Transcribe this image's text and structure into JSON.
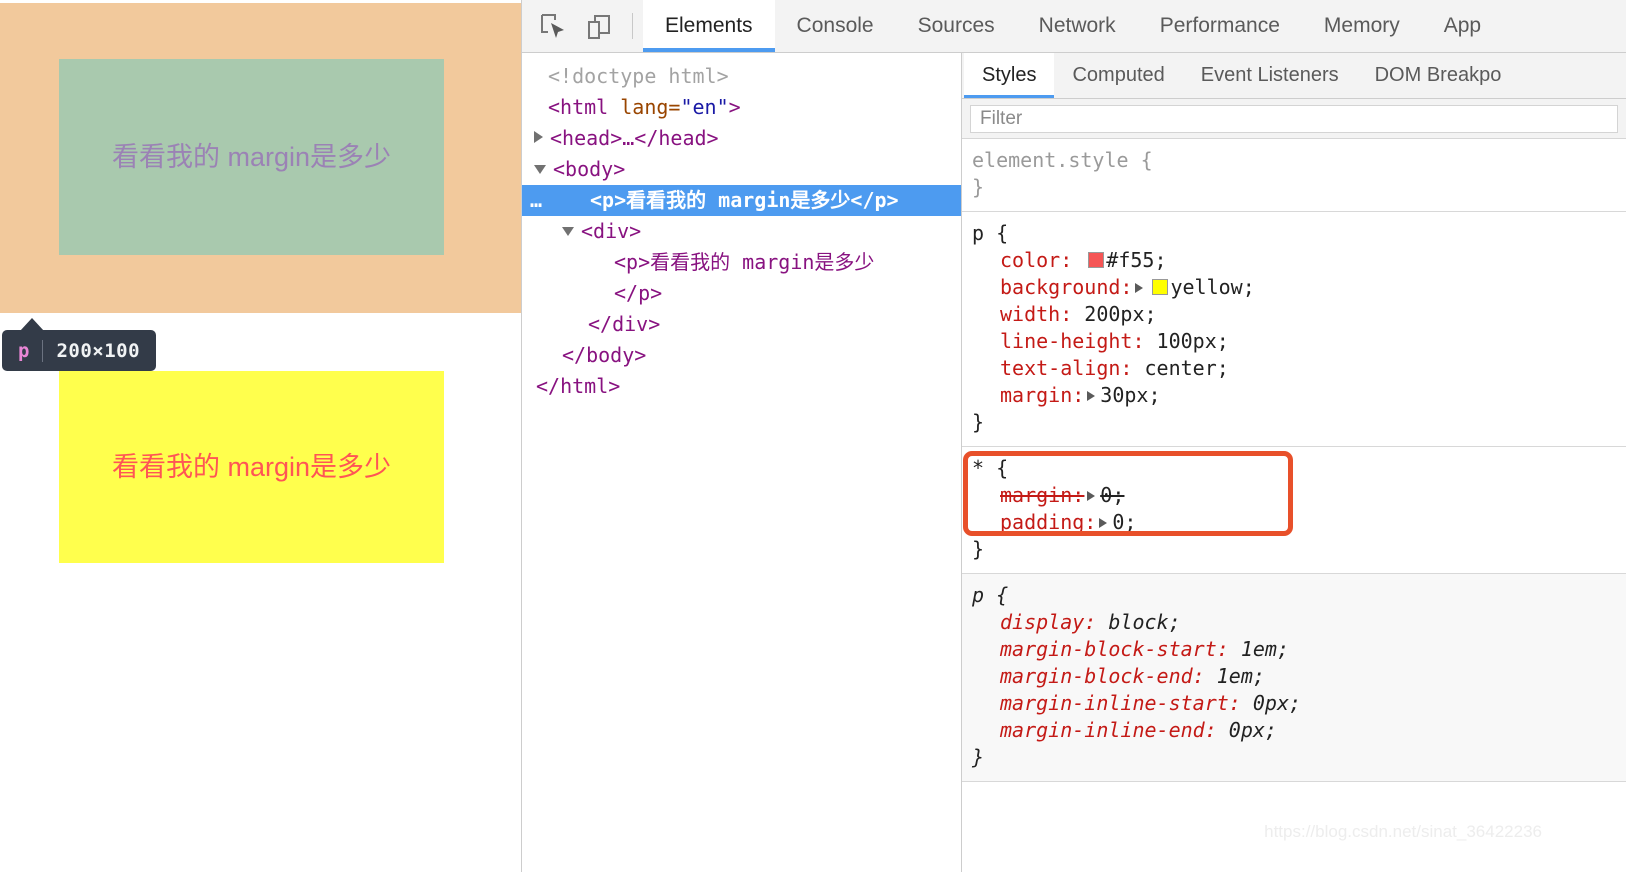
{
  "viewport": {
    "highlighted_element_text": "看看我的 margin是多少",
    "second_paragraph_text": "看看我的 margin是多少",
    "tooltip": {
      "tag": "p",
      "dimensions": "200×100"
    },
    "colors": {
      "margin_overlay": "#f2c99c",
      "content_overlay": "#a9c9ae",
      "paragraph_background": "#ffff4d",
      "paragraph_color": "#ff5555"
    }
  },
  "devtools": {
    "toolbar_icons": [
      {
        "name": "inspect-element-icon"
      },
      {
        "name": "device-toolbar-icon"
      }
    ],
    "tabs": [
      {
        "label": "Elements",
        "active": true
      },
      {
        "label": "Console",
        "active": false
      },
      {
        "label": "Sources",
        "active": false
      },
      {
        "label": "Network",
        "active": false
      },
      {
        "label": "Performance",
        "active": false
      },
      {
        "label": "Memory",
        "active": false
      },
      {
        "label": "App",
        "active": false
      }
    ],
    "dom_tree": [
      {
        "text": "<!doctype html>"
      },
      {
        "text": "<html lang=\"en\">"
      },
      {
        "text": "<head>…</head>"
      },
      {
        "text": "<body>"
      },
      {
        "text": "<p>看看我的 margin是多少</p>"
      },
      {
        "text": "<div>"
      },
      {
        "text": "<p>看看我的 margin是多少"
      },
      {
        "text": "</p>"
      },
      {
        "text": "</div>"
      },
      {
        "text": "</body>"
      },
      {
        "text": "</html>"
      }
    ],
    "dom_tokens": {
      "doctype": "<!doctype html>",
      "html_open_a": "<html ",
      "html_attr_name": "lang",
      "html_attr_eq": "=",
      "html_attr_val": "\"en\"",
      "html_open_b": ">",
      "head_line": "<head>…</head>",
      "body_open": "<body>",
      "selected_ellipsis": "…",
      "selected_p": "<p>看看我的 margin是多少</p>",
      "div_open": "<div>",
      "inner_p_open": "<p>看看我的 margin是多少",
      "inner_p_close": "</p>",
      "div_close": "</div>",
      "body_close": "</body>",
      "html_close": "</html>"
    },
    "styles_sidebar": {
      "tabs": [
        {
          "label": "Styles",
          "active": true
        },
        {
          "label": "Computed",
          "active": false
        },
        {
          "label": "Event Listeners",
          "active": false
        },
        {
          "label": "DOM Breakpo",
          "active": false
        }
      ],
      "filter_placeholder": "Filter",
      "rules": [
        {
          "selector": "element.style {",
          "closing": "}",
          "origin": "inline",
          "declarations": []
        },
        {
          "selector": "p {",
          "closing": "}",
          "origin": "author",
          "declarations": [
            {
              "name": "color:",
              "value": "#f55;",
              "swatch": "#f55555",
              "expandable": false,
              "overridden": false
            },
            {
              "name": "background:",
              "value": "yellow;",
              "swatch": "#ffff00",
              "expandable": true,
              "overridden": false
            },
            {
              "name": "width:",
              "value": "200px;",
              "expandable": false,
              "overridden": false
            },
            {
              "name": "line-height:",
              "value": "100px;",
              "expandable": false,
              "overridden": false
            },
            {
              "name": "text-align:",
              "value": "center;",
              "expandable": false,
              "overridden": false
            },
            {
              "name": "margin:",
              "value": "30px;",
              "expandable": true,
              "overridden": false
            }
          ]
        },
        {
          "selector": "* {",
          "closing": "}",
          "origin": "author",
          "declarations": [
            {
              "name": "margin:",
              "value": "0;",
              "expandable": true,
              "overridden": true
            },
            {
              "name": "padding:",
              "value": "0;",
              "expandable": true,
              "overridden": false
            }
          ]
        },
        {
          "selector": "p {",
          "closing": "}",
          "origin": "user-agent",
          "declarations": [
            {
              "name": "display:",
              "value": "block;",
              "expandable": false,
              "overridden": false
            },
            {
              "name": "margin-block-start:",
              "value": "1em;",
              "expandable": false,
              "overridden": false
            },
            {
              "name": "margin-block-end:",
              "value": "1em;",
              "expandable": false,
              "overridden": false
            },
            {
              "name": "margin-inline-start:",
              "value": "0px;",
              "expandable": false,
              "overridden": false
            },
            {
              "name": "margin-inline-end:",
              "value": "0px;",
              "expandable": false,
              "overridden": false
            }
          ]
        }
      ],
      "annotation": {
        "name": "margin-rule-highlight",
        "color": "#e8502a"
      }
    }
  },
  "watermark": "https://blog.csdn.net/sinat_36422236"
}
